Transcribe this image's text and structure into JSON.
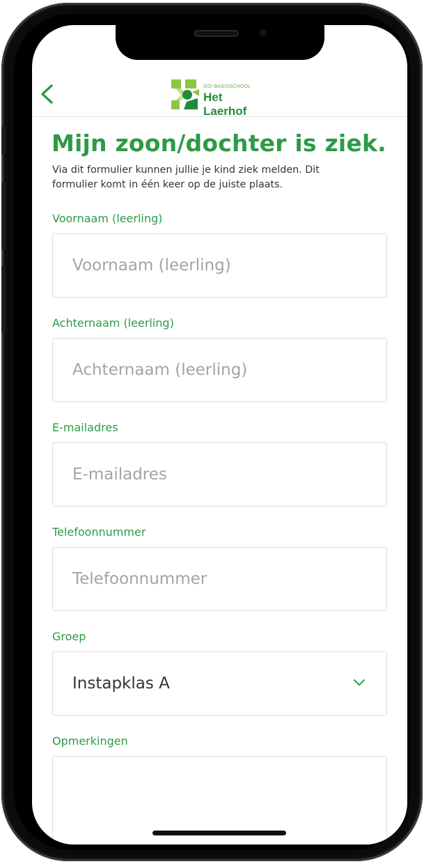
{
  "header": {
    "logo_small": "GO! BASISSCHOOL",
    "logo_name": "Het Laerhof",
    "colors": {
      "brand_green": "#2e9a46",
      "logo_light_green": "#8cc63f"
    }
  },
  "page": {
    "title": "Mijn zoon/dochter is ziek.",
    "intro": "Via dit formulier kunnen jullie je kind ziek melden. Dit formulier komt in één keer op de juiste plaats."
  },
  "form": {
    "voornaam": {
      "label": "Voornaam (leerling)",
      "placeholder": "Voornaam (leerling)"
    },
    "achternaam": {
      "label": "Achternaam (leerling)",
      "placeholder": "Achternaam (leerling)"
    },
    "email": {
      "label": "E-mailadres",
      "placeholder": "E-mailadres"
    },
    "telefoon": {
      "label": "Telefoonnummer",
      "placeholder": "Telefoonnummer"
    },
    "groep": {
      "label": "Groep",
      "value": "Instapklas A",
      "icon": "chevron-down-icon"
    },
    "opmerkingen": {
      "label": "Opmerkingen",
      "value": ""
    }
  }
}
